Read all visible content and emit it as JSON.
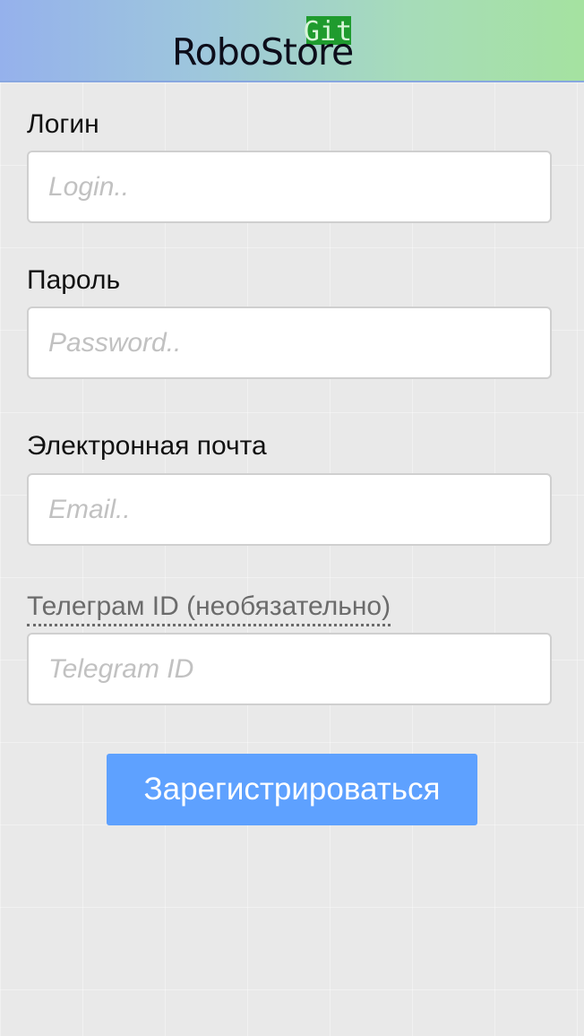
{
  "header": {
    "logo_text": "RoboStore",
    "logo_badge_text": "Git",
    "logo_badge_color": "#1f9b2e"
  },
  "form": {
    "login": {
      "label": "Логин",
      "placeholder": "Login.."
    },
    "password": {
      "label": "Пароль",
      "placeholder": "Password.."
    },
    "email": {
      "label": "Электронная почта",
      "placeholder": "Email.."
    },
    "telegram": {
      "label": "Телеграм ID (необязательно)",
      "placeholder": "Telegram ID"
    },
    "submit_label": "Зарегистрироваться"
  },
  "colors": {
    "header_gradient_start": "#95b1ec",
    "header_gradient_end": "#a5e2a0",
    "button": "#5ea1ff",
    "background": "#e9e9e9"
  }
}
